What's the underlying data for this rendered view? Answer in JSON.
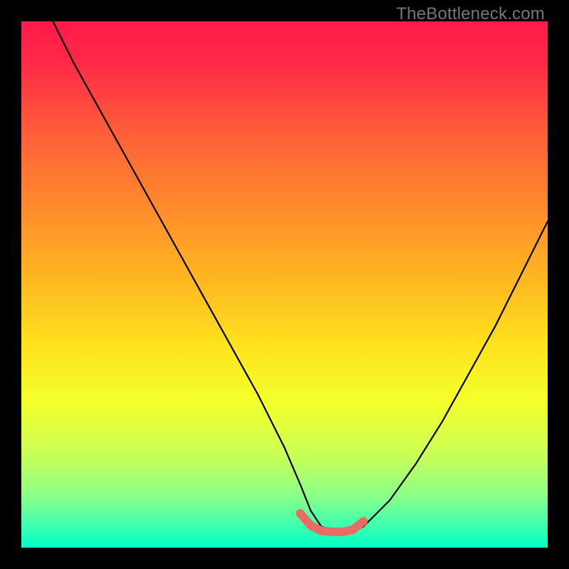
{
  "watermark": "TheBottleneck.com",
  "colors": {
    "frame": "#000000",
    "curve": "#000000",
    "accent": "#e86b64",
    "watermark_text": "#777777",
    "gradient_stops": [
      {
        "offset": 0.0,
        "color": "#ff1a4a"
      },
      {
        "offset": 0.08,
        "color": "#ff2a47"
      },
      {
        "offset": 0.2,
        "color": "#ff5a3a"
      },
      {
        "offset": 0.35,
        "color": "#ff8a2d"
      },
      {
        "offset": 0.5,
        "color": "#ffba20"
      },
      {
        "offset": 0.62,
        "color": "#ffe41e"
      },
      {
        "offset": 0.72,
        "color": "#f4ff2a"
      },
      {
        "offset": 0.82,
        "color": "#ccff55"
      },
      {
        "offset": 0.9,
        "color": "#8cff88"
      },
      {
        "offset": 0.96,
        "color": "#3cffb0"
      },
      {
        "offset": 1.0,
        "color": "#00ffc8"
      }
    ]
  },
  "chart_data": {
    "type": "line",
    "title": "",
    "xlabel": "",
    "ylabel": "",
    "xlim": [
      0,
      100
    ],
    "ylim": [
      0,
      100
    ],
    "categories_note": "No axis tick labels are shown in the image; x and y spans are normalized 0–100 from the visible plot area.",
    "series": [
      {
        "name": "bottleneck-curve",
        "x": [
          6,
          10,
          15,
          20,
          25,
          30,
          35,
          40,
          45,
          50,
          53,
          55,
          57,
          60,
          63,
          65,
          70,
          75,
          80,
          85,
          90,
          95,
          100
        ],
        "y": [
          100,
          92,
          83,
          74,
          65,
          56,
          47,
          38,
          29,
          19,
          12,
          7,
          4,
          3,
          3,
          4,
          9,
          16,
          24,
          33,
          42,
          52,
          62
        ]
      },
      {
        "name": "accent-segment",
        "x": [
          53,
          55,
          57,
          59,
          61,
          63,
          65
        ],
        "y": [
          6.5,
          4.2,
          3.2,
          3.0,
          3.0,
          3.4,
          5.0
        ]
      }
    ],
    "annotations": []
  }
}
